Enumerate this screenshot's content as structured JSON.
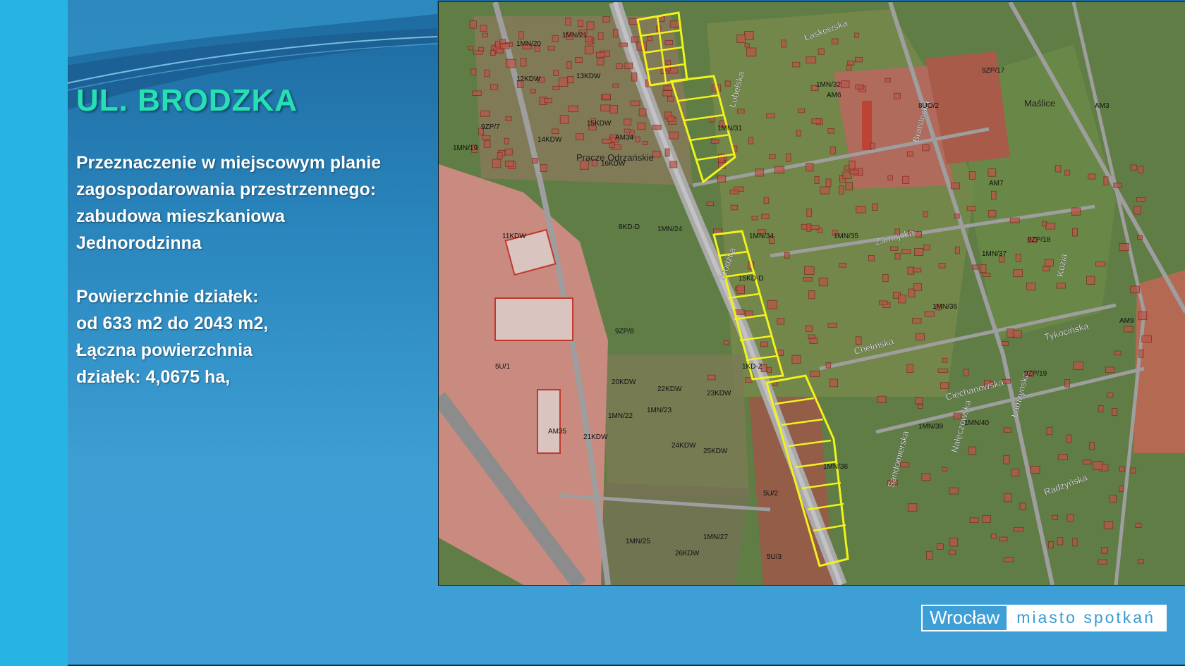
{
  "slide": {
    "title": "UL. BRODZKA",
    "description": [
      "Przeznaczenie w miejscowym planie",
      "zagospodarowania przestrzennego:",
      "zabudowa mieszkaniowa",
      "Jednorodzinna"
    ],
    "area": [
      "Powierzchnie działek:",
      "od 633 m2 do 2043 m2,",
      "Łączna powierzchnia",
      "działek: 4,0675  ha,"
    ]
  },
  "map": {
    "street_labels": [
      "Brodzka",
      "Chełmska",
      "Zamojska",
      "Bratślocka",
      "Lubelska",
      "Kozia",
      "Tykocińska",
      "Ciechanowska",
      "Łomżyńska",
      "Radzyńska",
      "Nałęczowska",
      "Sandomierska",
      "Łaskowska",
      "Maślice",
      "Pracze Odrzańskie"
    ],
    "zone_labels": [
      "1MN/20",
      "1MN/21",
      "1MN/31",
      "1MN/32",
      "1MN/34",
      "1MN/35",
      "1MN/36",
      "1MN/37",
      "1MN/38",
      "1MN/39",
      "1MN/40",
      "1MN/22",
      "1MN/23",
      "1MN/24",
      "1MN/25",
      "1MN/27",
      "9ZP/7",
      "9ZP/8",
      "9ZP/17",
      "9ZP/18",
      "9ZP/19",
      "5U/1",
      "5U/2",
      "5U/3",
      "8UO/2",
      "AM34",
      "AM35",
      "AM6",
      "AM7",
      "AM9",
      "AM3",
      "11KDW",
      "12KDW",
      "13KDW",
      "14KDW",
      "15KDW",
      "16KDW",
      "20KDW",
      "21KDW",
      "22KDW",
      "23KDW",
      "24KDW",
      "25KDW",
      "26KDW",
      "1KD-Z",
      "15KD-D",
      "8KD-D",
      "1MN/19"
    ],
    "colors": {
      "vegetation": "#5f7d45",
      "residential": "#7e8a55",
      "industrial": "#c98a80",
      "road": "#a9a9a9",
      "highlight": "#f2f21c",
      "building": "#c0392b"
    }
  },
  "logo": {
    "city": "Wrocław",
    "tagline": "miasto spotkań"
  }
}
